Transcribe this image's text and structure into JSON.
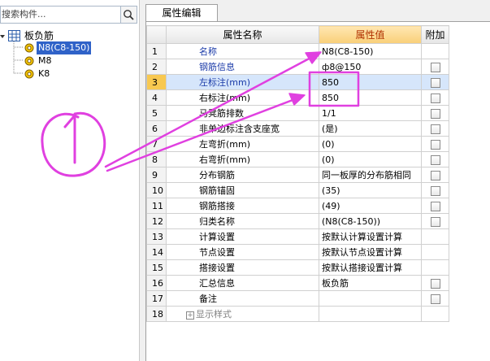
{
  "search": {
    "value": "搜索构件..."
  },
  "tree": {
    "root_label": "板负筋",
    "items": [
      {
        "label": "N8(C8-150)"
      },
      {
        "label": "M8"
      },
      {
        "label": "K8"
      }
    ]
  },
  "tab": {
    "label": "属性编辑"
  },
  "table": {
    "headers": {
      "name": "属性名称",
      "value": "属性值",
      "extra": "附加"
    },
    "rows": [
      {
        "num": "1",
        "name": "名称",
        "value": "N8(C8-150)",
        "checkbox": false
      },
      {
        "num": "2",
        "name": "钢筋信息",
        "value": "ф8@150",
        "checkbox": true
      },
      {
        "num": "3",
        "name": "左标注(mm)",
        "value": "850",
        "checkbox": true
      },
      {
        "num": "4",
        "name": "右标注(mm)",
        "value": "850",
        "checkbox": true
      },
      {
        "num": "5",
        "name": "马凳筋排数",
        "value": "1/1",
        "checkbox": true
      },
      {
        "num": "6",
        "name": "非单边标注含支座宽",
        "value": "(是)",
        "checkbox": true
      },
      {
        "num": "7",
        "name": "左弯折(mm)",
        "value": "(0)",
        "checkbox": true
      },
      {
        "num": "8",
        "name": "右弯折(mm)",
        "value": "(0)",
        "checkbox": true
      },
      {
        "num": "9",
        "name": "分布钢筋",
        "value": "同一板厚的分布筋相同",
        "checkbox": true
      },
      {
        "num": "10",
        "name": "钢筋锚固",
        "value": "(35)",
        "checkbox": true
      },
      {
        "num": "11",
        "name": "钢筋搭接",
        "value": "(49)",
        "checkbox": true
      },
      {
        "num": "12",
        "name": "归类名称",
        "value": "(N8(C8-150))",
        "checkbox": true
      },
      {
        "num": "13",
        "name": "计算设置",
        "value": "按默认计算设置计算",
        "checkbox": false
      },
      {
        "num": "14",
        "name": "节点设置",
        "value": "按默认节点设置计算",
        "checkbox": false
      },
      {
        "num": "15",
        "name": "搭接设置",
        "value": "按默认搭接设置计算",
        "checkbox": false
      },
      {
        "num": "16",
        "name": "汇总信息",
        "value": "板负筋",
        "checkbox": true
      },
      {
        "num": "17",
        "name": "备注",
        "value": "",
        "checkbox": true
      },
      {
        "num": "18",
        "name": "显示样式",
        "value": "",
        "checkbox": false
      }
    ]
  },
  "annotation": {
    "label": "①",
    "color": "#e040e0"
  },
  "colors": {
    "selection": "#2f62c8",
    "header_highlight": "#f9cf78",
    "active_row": "#d6e6fb",
    "blue_text": "#1a3aa8"
  }
}
